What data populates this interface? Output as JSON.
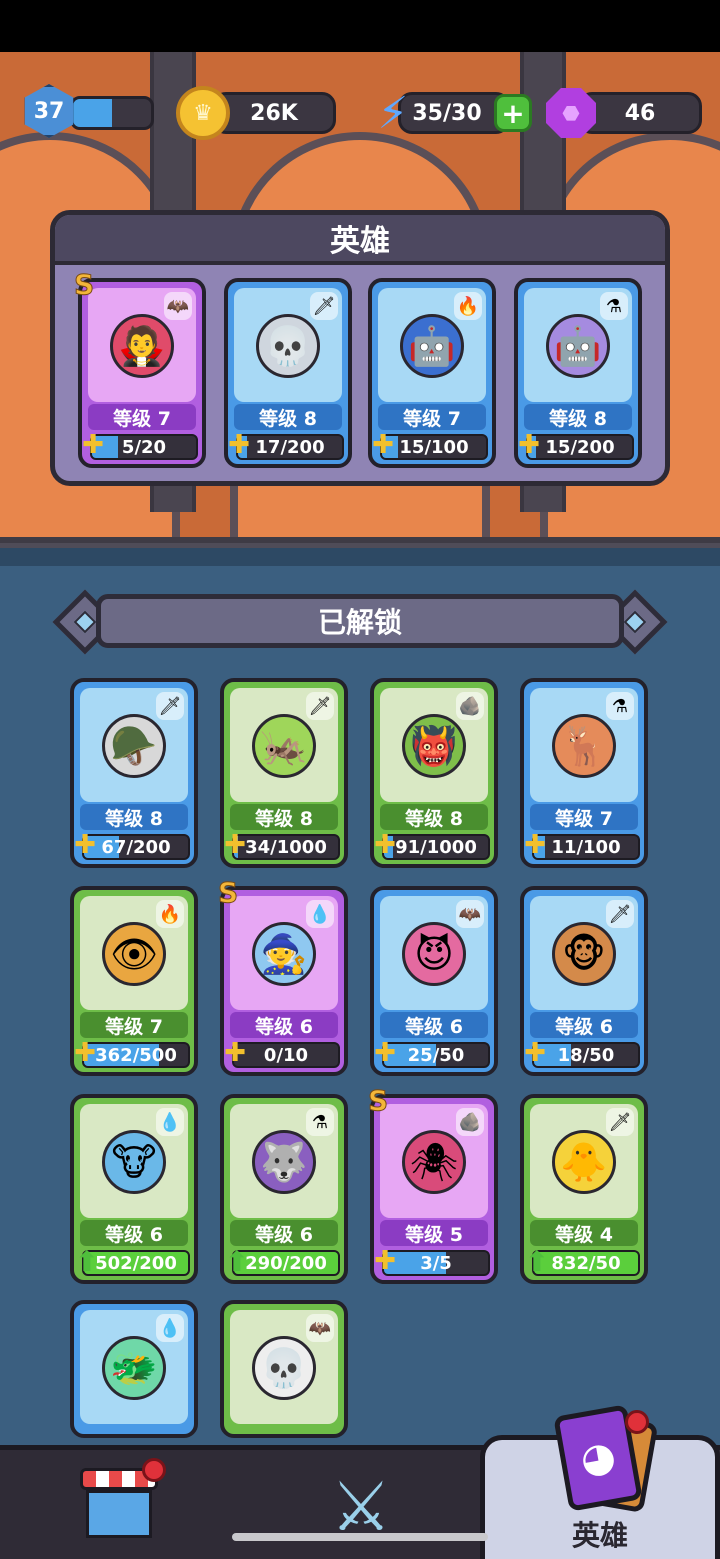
{
  "hud": {
    "player_level": "37",
    "xp_progress": 0.5,
    "coins": "26K",
    "energy": "35/30",
    "gems": "46"
  },
  "hero_panel": {
    "title": "英雄",
    "cards": [
      {
        "level": "等级 7",
        "progress": "5/20",
        "fill": 0.25,
        "rarity": "purple",
        "srank": "S",
        "element": "bat",
        "face": "🧛",
        "face_bg": "#e04b6a"
      },
      {
        "level": "等级 8",
        "progress": "17/200",
        "fill": 0.085,
        "rarity": "blue",
        "srank": "",
        "element": "sword",
        "face": "💀",
        "face_bg": "#cfd6de"
      },
      {
        "level": "等级 7",
        "progress": "15/100",
        "fill": 0.15,
        "rarity": "blue",
        "srank": "",
        "element": "fire",
        "face": "🤖",
        "face_bg": "#3b6fd0"
      },
      {
        "level": "等级 8",
        "progress": "15/200",
        "fill": 0.075,
        "rarity": "blue",
        "srank": "",
        "element": "potion",
        "face": "🤖",
        "face_bg": "#a58be0"
      }
    ]
  },
  "unlocked": {
    "title": "已解锁",
    "cards": [
      {
        "level": "等级 8",
        "progress": "67/200",
        "fill": 0.335,
        "rarity": "blue",
        "srank": "",
        "element": "sword",
        "face": "🪖",
        "face_bg": "#d8d8d8",
        "ready": false
      },
      {
        "level": "等级 8",
        "progress": "34/1000",
        "fill": 0.034,
        "rarity": "green",
        "srank": "",
        "element": "sword",
        "face": "🦗",
        "face_bg": "#9fd65a",
        "ready": false
      },
      {
        "level": "等级 8",
        "progress": "91/1000",
        "fill": 0.091,
        "rarity": "green",
        "srank": "",
        "element": "rock",
        "face": "👹",
        "face_bg": "#7fbf4a",
        "ready": false
      },
      {
        "level": "等级 7",
        "progress": "11/100",
        "fill": 0.11,
        "rarity": "blue",
        "srank": "",
        "element": "potion",
        "face": "🦌",
        "face_bg": "#e58b5a",
        "ready": false
      },
      {
        "level": "等级 7",
        "progress": "362/500",
        "fill": 0.724,
        "rarity": "green",
        "srank": "",
        "element": "fire",
        "face": "👁",
        "face_bg": "#e9a640",
        "ready": false
      },
      {
        "level": "等级 6",
        "progress": "0/10",
        "fill": 0.0,
        "rarity": "purple",
        "srank": "S",
        "element": "water",
        "face": "🧙",
        "face_bg": "#8fc8f0",
        "ready": false
      },
      {
        "level": "等级 6",
        "progress": "25/50",
        "fill": 0.5,
        "rarity": "blue",
        "srank": "",
        "element": "bat",
        "face": "😈",
        "face_bg": "#e46aa0",
        "ready": false
      },
      {
        "level": "等级 6",
        "progress": "18/50",
        "fill": 0.36,
        "rarity": "blue",
        "srank": "",
        "element": "sword",
        "face": "🐵",
        "face_bg": "#d48a4a",
        "ready": false
      },
      {
        "level": "等级 6",
        "progress": "502/200",
        "fill": 1.0,
        "rarity": "green",
        "srank": "",
        "element": "water",
        "face": "🐮",
        "face_bg": "#6ab8e8",
        "ready": true
      },
      {
        "level": "等级 6",
        "progress": "290/200",
        "fill": 1.0,
        "rarity": "green",
        "srank": "",
        "element": "potion",
        "face": "🐺",
        "face_bg": "#8a5fc0",
        "ready": true
      },
      {
        "level": "等级 5",
        "progress": "3/5",
        "fill": 0.6,
        "rarity": "purple",
        "srank": "S",
        "element": "rock",
        "face": "🕷",
        "face_bg": "#d94b7a",
        "ready": false
      },
      {
        "level": "等级 4",
        "progress": "832/50",
        "fill": 1.0,
        "rarity": "green",
        "srank": "",
        "element": "sword",
        "face": "🐥",
        "face_bg": "#f5d23a",
        "ready": true
      },
      {
        "level": "",
        "progress": "",
        "fill": 0,
        "rarity": "blue",
        "srank": "",
        "element": "water",
        "face": "🐲",
        "face_bg": "#6fd8a8",
        "ready": false
      },
      {
        "level": "",
        "progress": "",
        "fill": 0,
        "rarity": "green",
        "srank": "",
        "element": "bat",
        "face": "💀",
        "face_bg": "#eeeeee",
        "ready": false
      }
    ]
  },
  "nav": {
    "shop": "shop",
    "battle": "battle",
    "heroes_label": "英雄"
  },
  "element_glyphs": {
    "bat": "🦇",
    "sword": "🗡",
    "fire": "🔥",
    "potion": "⚗",
    "water": "💧",
    "rock": "🪨"
  }
}
